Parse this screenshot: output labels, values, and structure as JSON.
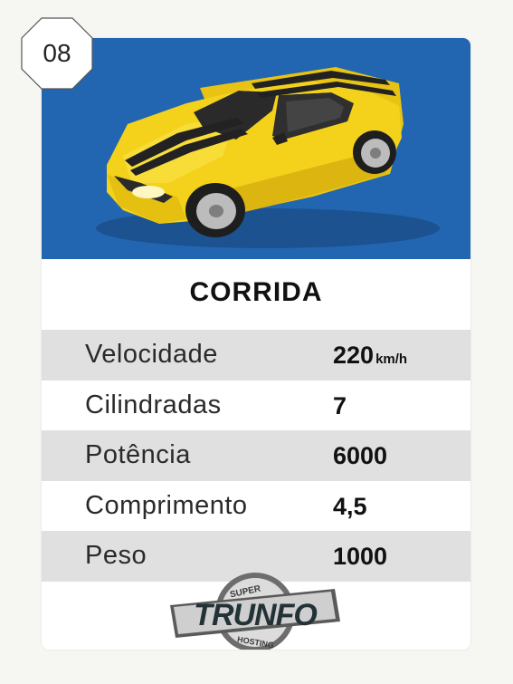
{
  "badge": {
    "number": "08"
  },
  "card": {
    "title": "CORRIDA",
    "stats": [
      {
        "label": "Velocidade",
        "value": "220",
        "unit": "km/h"
      },
      {
        "label": "Cilindradas",
        "value": "7",
        "unit": ""
      },
      {
        "label": "Potência",
        "value": "6000",
        "unit": ""
      },
      {
        "label": "Comprimento",
        "value": "4,5",
        "unit": ""
      },
      {
        "label": "Peso",
        "value": "1000",
        "unit": ""
      }
    ]
  },
  "logo": {
    "top": "SUPER",
    "word": "TRUNFO",
    "bottom": "HOSTING"
  },
  "colors": {
    "hero_bg": "#2266b1",
    "car_body": "#f4d21c",
    "row_shade": "#e0e0e0"
  },
  "icons": {
    "hero_image": "yellow-sports-car-icon"
  }
}
